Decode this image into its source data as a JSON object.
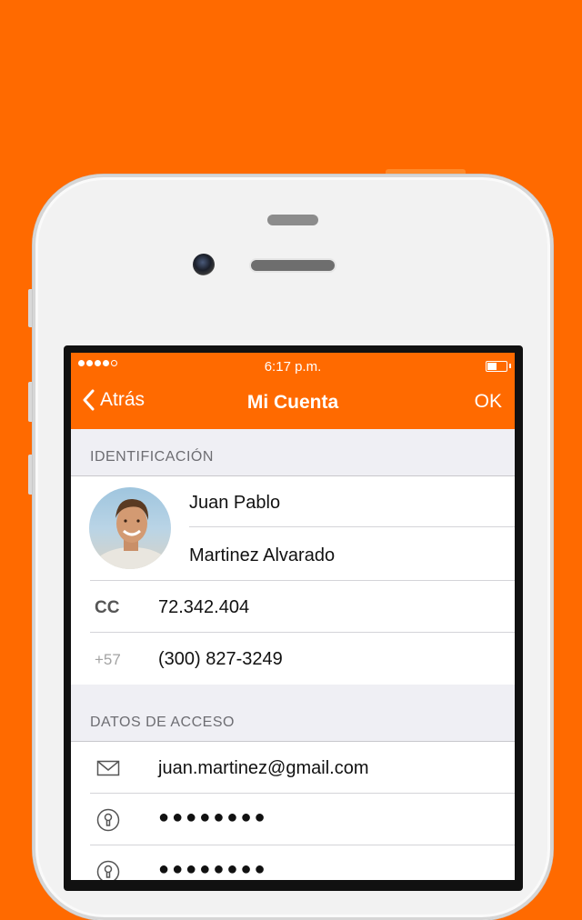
{
  "status_bar": {
    "time": "6:17 p.m."
  },
  "nav": {
    "back_label": "Atrás",
    "title": "Mi Cuenta",
    "ok_label": "OK"
  },
  "identification": {
    "header": "IDENTIFICACIÓN",
    "first_name": "Juan Pablo",
    "last_name": "Martinez Alvarado",
    "id_prefix": "CC",
    "id_number": "72.342.404",
    "phone_prefix": "+57",
    "phone": "(300) 827-3249"
  },
  "access": {
    "header": "DATOS DE ACCESO",
    "email": "juan.martinez@gmail.com",
    "password": "●●●●●●●●",
    "password_confirm": "●●●●●●●●"
  },
  "colors": {
    "accent": "#ff6a00",
    "background": "#efeff4"
  },
  "icons": {
    "back": "chevron-left-icon",
    "email": "envelope-icon",
    "password": "lock-icon",
    "avatar": "profile-photo"
  }
}
